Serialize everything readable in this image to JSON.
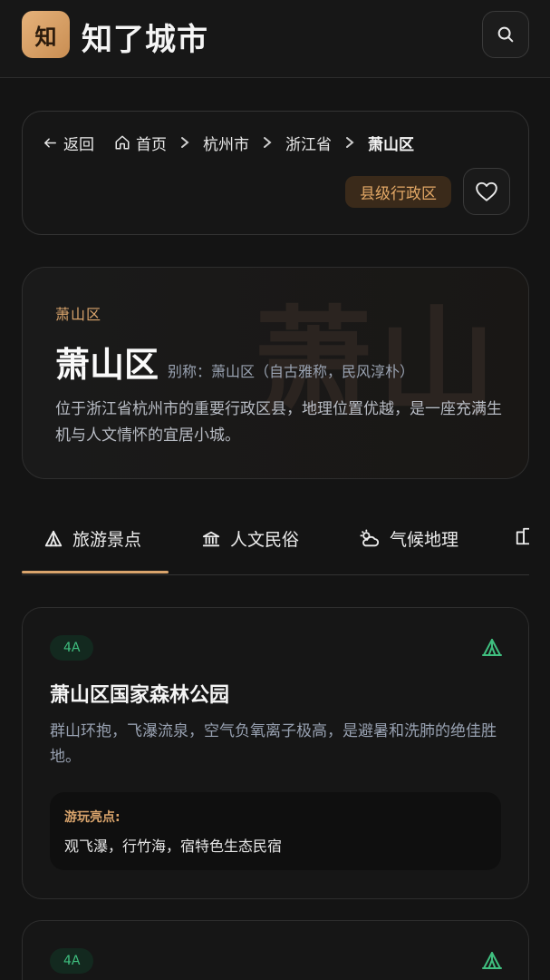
{
  "header": {
    "logo_char": "知",
    "app_title": "知了城市",
    "search_icon": "search-icon"
  },
  "breadcrumb": {
    "back_label": "返回",
    "home_label": "首页",
    "items": [
      "杭州市",
      "浙江省",
      "萧山区"
    ]
  },
  "region": {
    "level_badge": "县级行政区",
    "eyebrow": "萧山区",
    "name": "萧山区",
    "alias": "别称：萧山区（自古雅称，民风淳朴）",
    "description": "位于浙江省杭州市的重要行政区县，地理位置优越，是一座充满生机与人文情怀的宜居小城。",
    "watermark": "萧山"
  },
  "tabs": [
    {
      "label": "旅游景点",
      "icon": "tent-icon",
      "active": true
    },
    {
      "label": "人文民俗",
      "icon": "museum-icon",
      "active": false
    },
    {
      "label": "气候地理",
      "icon": "weather-icon",
      "active": false
    },
    {
      "label": "",
      "icon": "building-icon",
      "active": false
    }
  ],
  "spots": [
    {
      "rating": "4A",
      "title": "萧山区国家森林公园",
      "description": "群山环抱，飞瀑流泉，空气负氧离子极高，是避暑和洗肺的绝佳胜地。",
      "highlight_label": "游玩亮点:",
      "highlight_text": "观飞瀑，行竹海，宿特色生态民宿"
    },
    {
      "rating": "4A"
    }
  ],
  "colors": {
    "accent": "#d9a46c",
    "rating_green": "#3fbf7f",
    "background": "#141414"
  }
}
